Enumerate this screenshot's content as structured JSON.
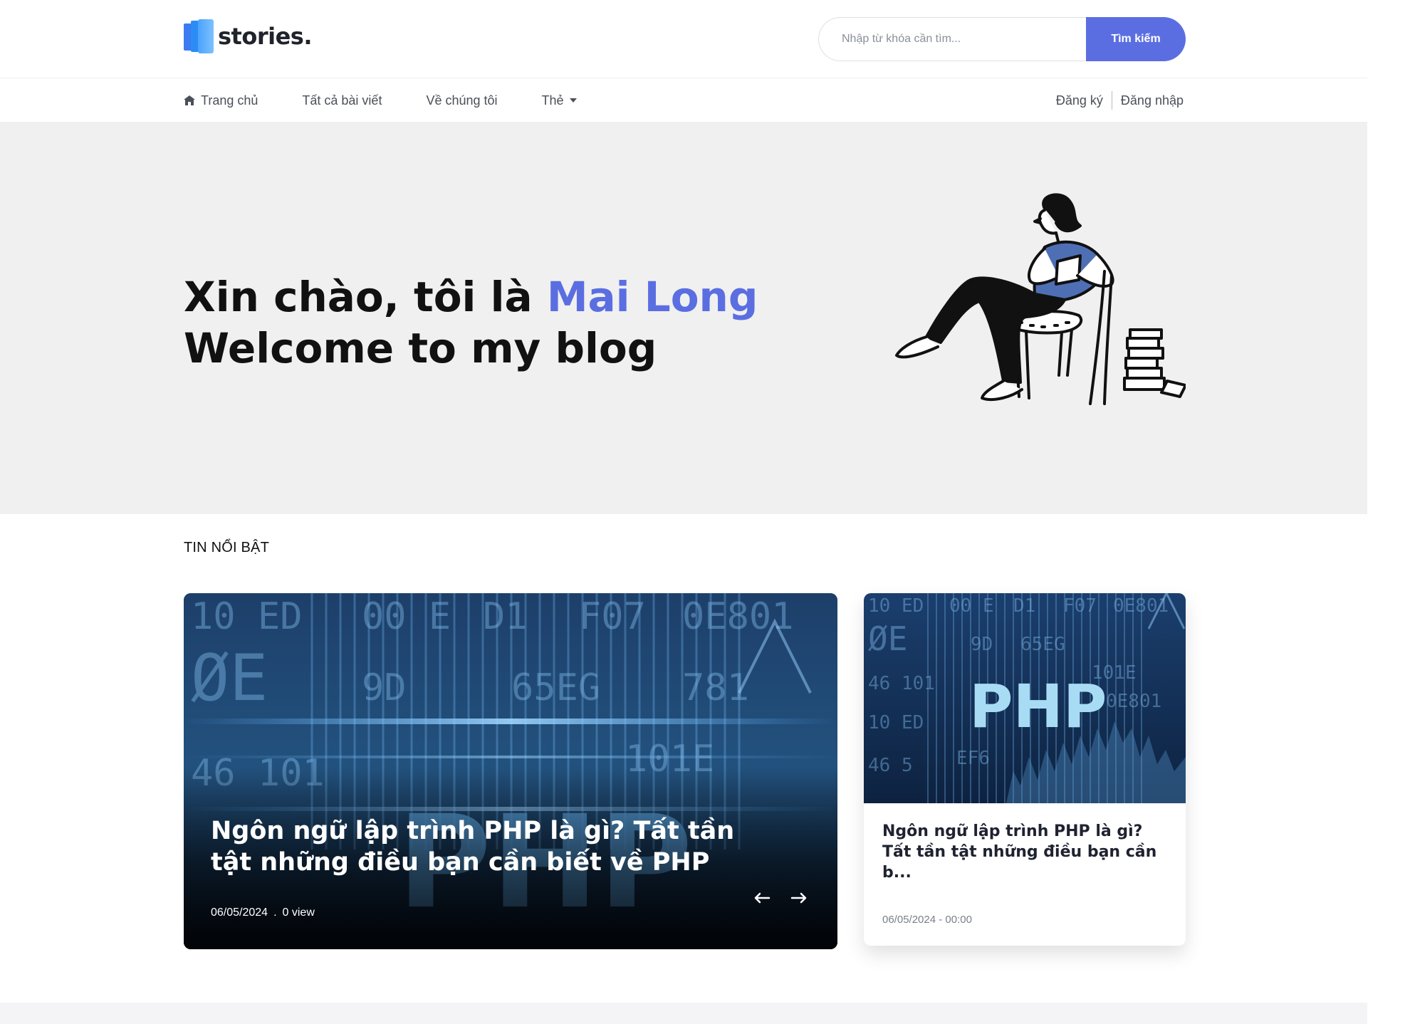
{
  "header": {
    "logo_text": "stories.",
    "search": {
      "placeholder": "Nhập từ khóa cần tìm...",
      "button_label": "Tìm kiếm"
    }
  },
  "nav": {
    "items": [
      {
        "label": "Trang chủ",
        "icon": "home-icon"
      },
      {
        "label": "Tất cả bài viết"
      },
      {
        "label": "Về chúng tôi"
      },
      {
        "label": "Thẻ",
        "icon": "caret-down-icon"
      }
    ],
    "auth": {
      "register": "Đăng ký",
      "login": "Đăng nhập"
    }
  },
  "hero": {
    "greeting": "Xin chào, tôi là ",
    "name": "Mai Long",
    "subtitle": "Welcome to my blog",
    "illustration": "person-reading-illustration"
  },
  "featured": {
    "section_title": "TIN NỔI BẬT",
    "main": {
      "title": "Ngôn ngữ lập trình PHP là gì? Tất tần tật những điều bạn cần biết về PHP",
      "date": "06/05/2024",
      "views": "0 view",
      "separator": "."
    },
    "side": {
      "title": "Ngôn ngữ lập trình PHP là gì? Tất tần tật những điều bạn cần b...",
      "meta": "06/05/2024 - 00:00"
    }
  },
  "colors": {
    "accent": "#5b6ee1",
    "hero_bg": "#f0f0f0",
    "text": "#111111"
  }
}
